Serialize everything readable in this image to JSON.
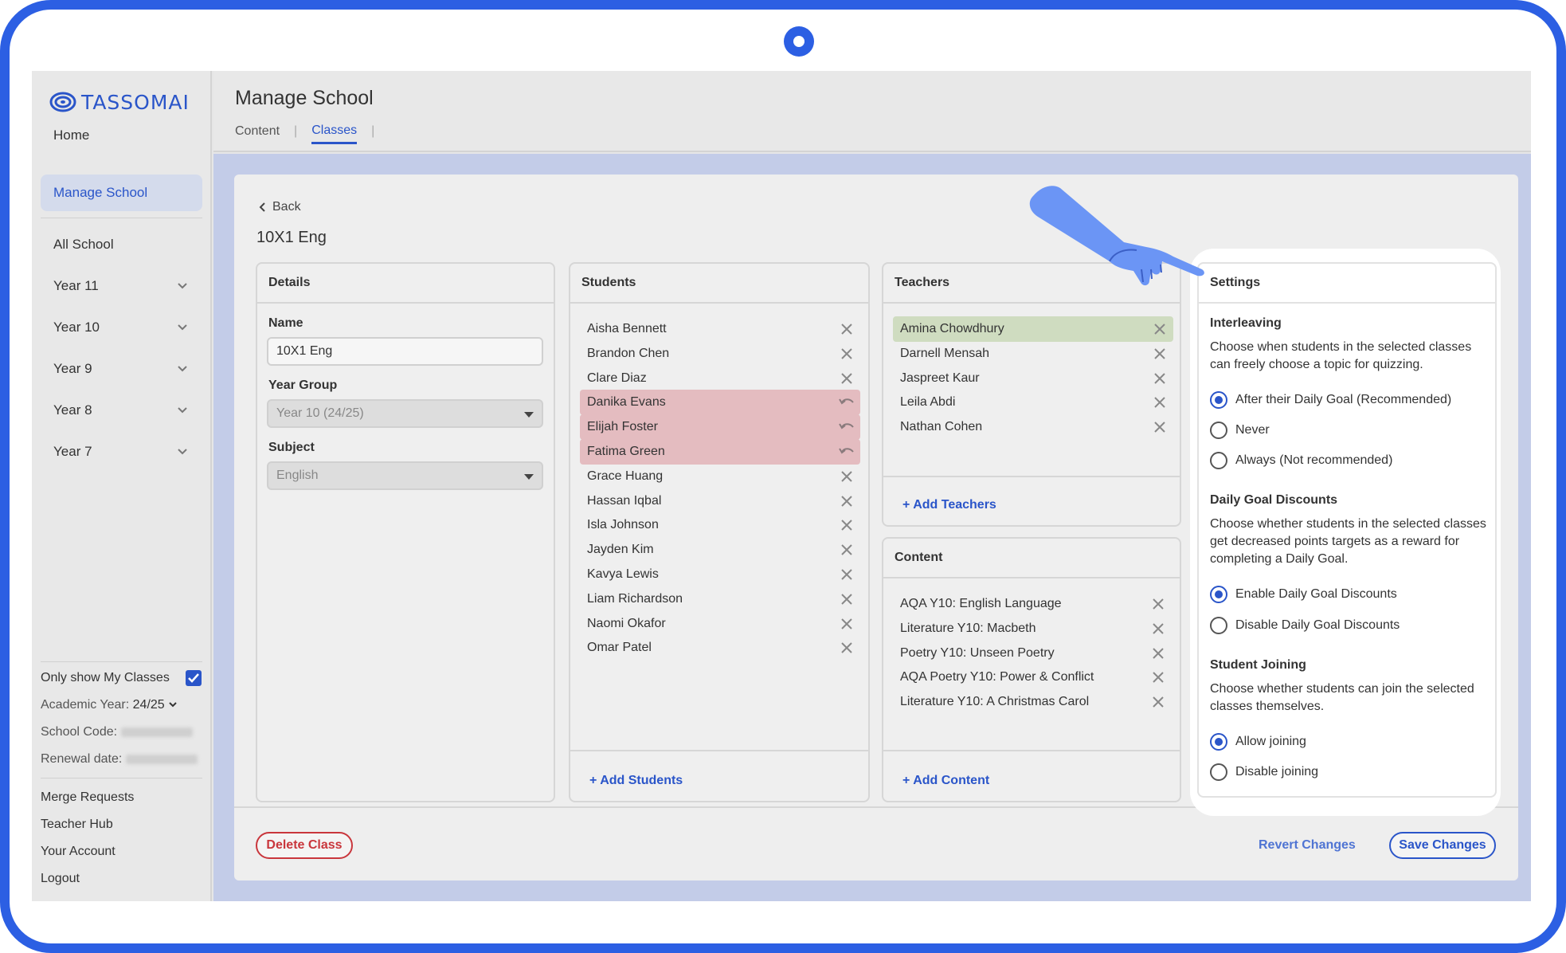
{
  "brand": {
    "name": "TASSOMAI",
    "color": "#2a55c9"
  },
  "sidebar": {
    "items": [
      {
        "label": "Home"
      },
      {
        "label": "Manage School",
        "active": true
      },
      {
        "label": "All School"
      },
      {
        "label": "Year 11",
        "icon": "chevron-down-icon"
      },
      {
        "label": "Year 10",
        "icon": "chevron-down-icon"
      },
      {
        "label": "Year 9",
        "icon": "chevron-down-icon"
      },
      {
        "label": "Year 8",
        "icon": "chevron-down-icon"
      },
      {
        "label": "Year 7",
        "icon": "chevron-down-icon"
      }
    ],
    "only_my_classes": {
      "label": "Only show My Classes",
      "checked": true
    },
    "academic_year": {
      "label": "Academic Year:",
      "value": "24/25"
    },
    "school_code": {
      "label": "School Code:"
    },
    "renewal_date": {
      "label": "Renewal date:"
    },
    "links": [
      {
        "label": "Merge Requests"
      },
      {
        "label": "Teacher Hub"
      },
      {
        "label": "Your Account"
      },
      {
        "label": "Logout"
      }
    ]
  },
  "header": {
    "title": "Manage School",
    "tabs": [
      {
        "label": "Content"
      },
      {
        "label": "Classes",
        "active": true
      }
    ]
  },
  "class_view": {
    "back_label": "Back",
    "title": "10X1 Eng",
    "details": {
      "heading": "Details",
      "name_label": "Name",
      "name_value": "10X1 Eng",
      "year_group_label": "Year Group",
      "year_group_value": "Year 10 (24/25)",
      "subject_label": "Subject",
      "subject_value": "English"
    },
    "students": {
      "heading": "Students",
      "items": [
        {
          "name": "Aisha Bennett",
          "state": "normal"
        },
        {
          "name": "Brandon Chen",
          "state": "normal"
        },
        {
          "name": "Clare Diaz",
          "state": "normal"
        },
        {
          "name": "Danika Evans",
          "state": "removed"
        },
        {
          "name": "Elijah Foster",
          "state": "removed"
        },
        {
          "name": "Fatima Green",
          "state": "removed"
        },
        {
          "name": "Grace Huang",
          "state": "normal"
        },
        {
          "name": "Hassan Iqbal",
          "state": "normal"
        },
        {
          "name": "Isla Johnson",
          "state": "normal"
        },
        {
          "name": "Jayden Kim",
          "state": "normal"
        },
        {
          "name": "Kavya Lewis",
          "state": "normal"
        },
        {
          "name": "Liam Richardson",
          "state": "normal"
        },
        {
          "name": "Naomi Okafor",
          "state": "normal"
        },
        {
          "name": "Omar Patel",
          "state": "normal"
        }
      ],
      "add_label": "+ Add Students"
    },
    "teachers": {
      "heading": "Teachers",
      "items": [
        {
          "name": "Amina Chowdhury",
          "state": "added"
        },
        {
          "name": "Darnell Mensah",
          "state": "normal"
        },
        {
          "name": "Jaspreet Kaur",
          "state": "normal"
        },
        {
          "name": "Leila Abdi",
          "state": "normal"
        },
        {
          "name": "Nathan Cohen",
          "state": "normal"
        }
      ],
      "add_label": "+ Add Teachers"
    },
    "content": {
      "heading": "Content",
      "items": [
        {
          "name": "AQA Y10: English Language"
        },
        {
          "name": "Literature Y10: Macbeth"
        },
        {
          "name": "Poetry Y10: Unseen Poetry"
        },
        {
          "name": "AQA Poetry Y10: Power & Conflict"
        },
        {
          "name": "Literature Y10: A Christmas Carol"
        }
      ],
      "add_label": "+ Add Content"
    },
    "settings": {
      "heading": "Settings",
      "interleaving": {
        "title": "Interleaving",
        "description": "Choose when students in the selected classes can freely choose a topic for quizzing.",
        "options": [
          {
            "label": "After their Daily Goal (Recommended)",
            "selected": true
          },
          {
            "label": "Never",
            "selected": false
          },
          {
            "label": "Always (Not recommended)",
            "selected": false
          }
        ]
      },
      "daily_goal": {
        "title": "Daily Goal Discounts",
        "description": "Choose whether students in the selected classes get decreased points targets as a reward for completing a Daily Goal.",
        "options": [
          {
            "label": "Enable Daily Goal Discounts",
            "selected": true
          },
          {
            "label": "Disable Daily Goal Discounts",
            "selected": false
          }
        ]
      },
      "joining": {
        "title": "Student Joining",
        "description": "Choose whether students can join the selected classes themselves.",
        "options": [
          {
            "label": "Allow joining",
            "selected": true
          },
          {
            "label": "Disable joining",
            "selected": false
          }
        ]
      }
    },
    "actions": {
      "delete_label": "Delete Class",
      "revert_label": "Revert Changes",
      "save_label": "Save Changes"
    }
  },
  "colors": {
    "accent": "#2a55c9",
    "removed_row": "#e4bcc0",
    "added_row": "#cfdcc0",
    "danger": "#c9363c",
    "pointer_hand": "#6b95f5"
  }
}
